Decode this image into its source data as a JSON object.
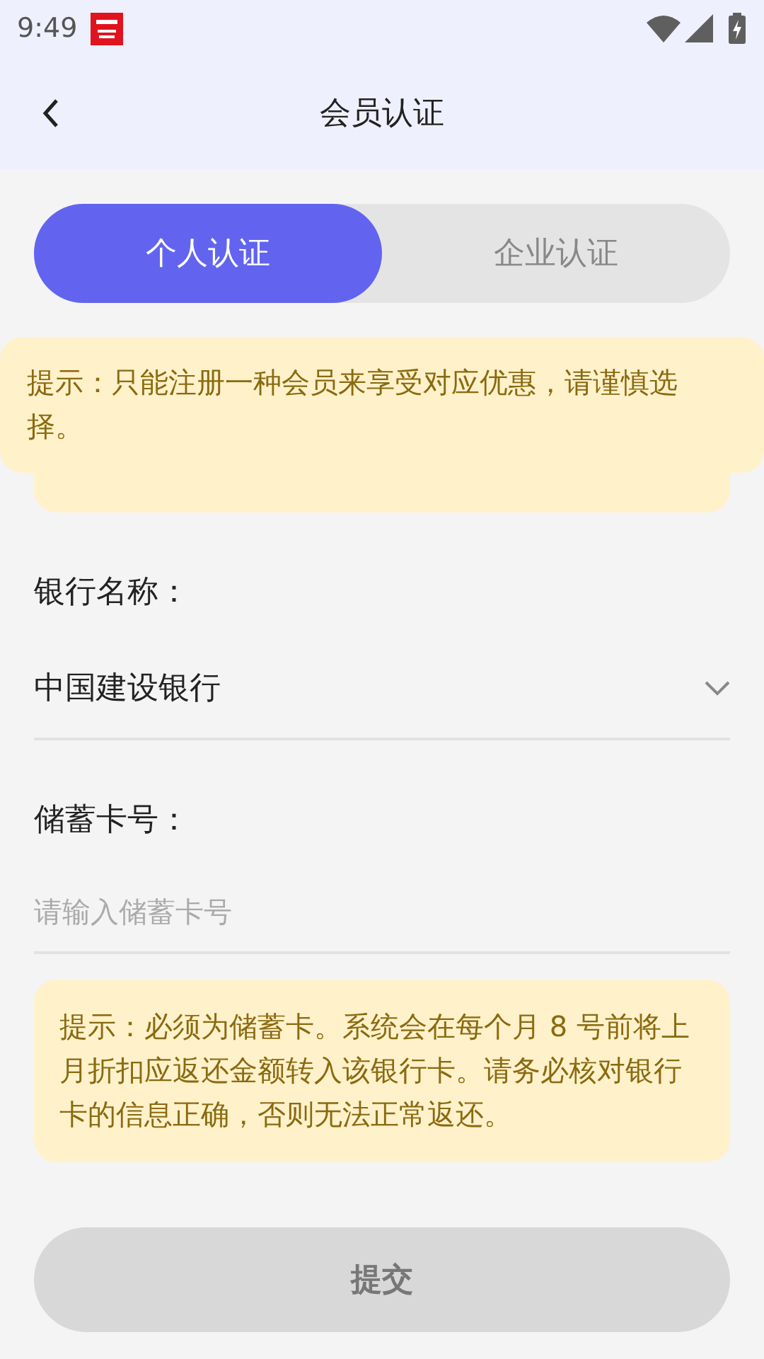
{
  "status_bar": {
    "time": "9:49"
  },
  "header": {
    "title": "会员认证"
  },
  "tabs": [
    {
      "label": "个人认证",
      "selected": true
    },
    {
      "label": "企业认证",
      "selected": false
    }
  ],
  "toast": {
    "text": "提示：只能注册一种会员来享受对应优惠，请谨慎选择。"
  },
  "form": {
    "bank_label": "银行名称：",
    "bank_value": "中国建设银行",
    "card_label": "储蓄卡号：",
    "card_placeholder": "请输入储蓄卡号"
  },
  "notice": {
    "text": "提示：必须为储蓄卡。系统会在每个月 8 号前将上月折扣应返还金额转入该银行卡。请务必核对银行卡的信息正确，否则无法正常返还。"
  },
  "submit": {
    "label": "提交",
    "disabled": true
  }
}
